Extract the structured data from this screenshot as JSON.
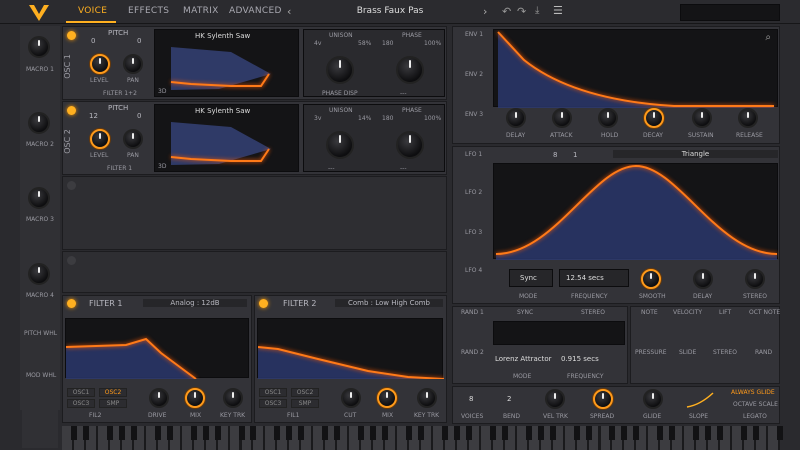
{
  "header": {
    "tabs": [
      "VOICE",
      "EFFECTS",
      "MATRIX",
      "ADVANCED"
    ],
    "preset": "Brass Faux Pas"
  },
  "macros": [
    "MACRO 1",
    "MACRO 2",
    "MACRO 3",
    "MACRO 4"
  ],
  "side_labels": [
    "PITCH WHL",
    "MOD WHL"
  ],
  "osc": [
    {
      "label": "OSC 1",
      "pitch_label": "PITCH",
      "pitch_left": "0",
      "pitch_right": "0",
      "wave": "HK Sylenth Saw",
      "level": "LEVEL",
      "pan": "PAN",
      "filter": "FILTER 1+2",
      "unison": "UNISON",
      "voices": "4v",
      "pct": "58%",
      "phase": "PHASE",
      "phase_val": "180",
      "phase_pct": "100%",
      "disp": "PHASE DISP",
      "threeD": "3D",
      "dash": "---"
    },
    {
      "label": "OSC 2",
      "pitch_label": "PITCH",
      "pitch_left": "12",
      "pitch_right": "0",
      "wave": "HK Sylenth Saw",
      "level": "LEVEL",
      "pan": "PAN",
      "filter": "FILTER 1",
      "unison": "UNISON",
      "voices": "3v",
      "pct": "14%",
      "phase": "PHASE",
      "phase_val": "180",
      "phase_pct": "100%",
      "disp": "---",
      "threeD": "3D",
      "dash": "---"
    }
  ],
  "filters": [
    {
      "title": "FILTER 1",
      "type": "Analog : 12dB",
      "b1": "OSC1",
      "b2": "OSC2",
      "b3": "OSC3",
      "b4": "SMP",
      "fil": "FIL2",
      "k1": "DRIVE",
      "k2": "MIX",
      "k3": "KEY TRK"
    },
    {
      "title": "FILTER 2",
      "type": "Comb : Low High Comb",
      "b1": "OSC1",
      "b2": "OSC2",
      "b3": "OSC3",
      "b4": "SMP",
      "fil": "FIL1",
      "k1": "CUT",
      "k2": "MIX",
      "k3": "KEY TRK"
    }
  ],
  "env": {
    "tabs": [
      "ENV 1",
      "ENV 2",
      "ENV 3"
    ],
    "knobs": [
      "DELAY",
      "ATTACK",
      "HOLD",
      "DECAY",
      "SUSTAIN",
      "RELEASE"
    ]
  },
  "lfo": {
    "tabs": [
      "LFO 1",
      "LFO 2",
      "LFO 3",
      "LFO 4"
    ],
    "rate_num": "8",
    "rate_den": "1",
    "shape": "Triangle",
    "mode_val": "Sync",
    "mode": "MODE",
    "freq_val": "12.54 secs",
    "freq": "FREQUENCY",
    "smooth": "SMOOTH",
    "delay": "DELAY",
    "stereo": "STEREO"
  },
  "rand": {
    "tabs": [
      "RAND 1",
      "RAND 2"
    ],
    "sync": "SYNC",
    "stereo": "STEREO",
    "mode_val": "Lorenz Attractor",
    "mode": "MODE",
    "freq_val": "0.915 secs",
    "freq": "FREQUENCY"
  },
  "voice": {
    "voices_val": "8",
    "voices": "VOICES",
    "bend_val": "2",
    "bend": "BEND",
    "vel": "VEL TRK",
    "spread": "SPREAD",
    "glide": "GLIDE",
    "slope": "SLOPE",
    "always": "ALWAYS GLIDE",
    "octave": "OCTAVE SCALE",
    "legato": "LEGATO"
  },
  "mods": {
    "row1": [
      "NOTE",
      "VELOCITY",
      "LIFT",
      "OCT NOTE"
    ],
    "row2": [
      "PRESSURE",
      "SLIDE",
      "STEREO",
      "RAND"
    ]
  },
  "chart_data": {
    "type": "line",
    "title": "",
    "series": [
      {
        "name": "",
        "values": []
      }
    ]
  }
}
